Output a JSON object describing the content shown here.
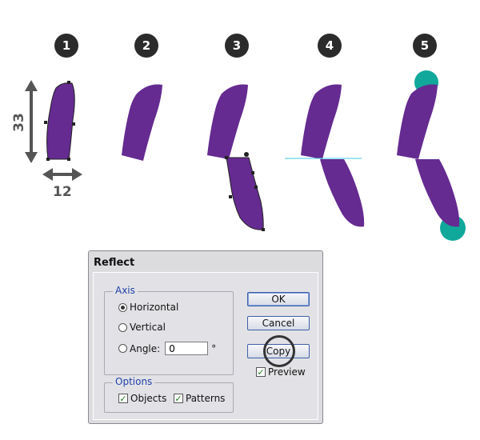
{
  "steps": [
    "1",
    "2",
    "3",
    "4",
    "5"
  ],
  "dimensions": {
    "height": "33",
    "width": "12"
  },
  "colors": {
    "shape": "#652b91",
    "accent": "#10a89a",
    "guide": "#3fc8ea"
  },
  "dialog": {
    "title": "Reflect",
    "axis": {
      "label": "Axis",
      "horizontal": "Horizontal",
      "vertical": "Vertical",
      "angle": "Angle:",
      "angle_value": "0",
      "degree": "°",
      "selected": "horizontal"
    },
    "options": {
      "label": "Options",
      "objects": "Objects",
      "patterns": "Patterns"
    },
    "buttons": {
      "ok": "OK",
      "cancel": "Cancel",
      "copy": "Copy"
    },
    "preview": "Preview"
  }
}
